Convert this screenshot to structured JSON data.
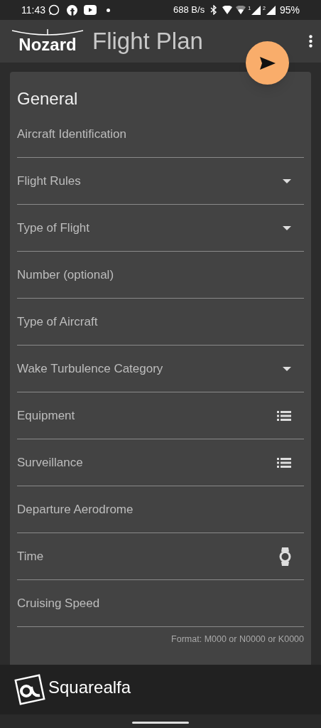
{
  "status_bar": {
    "time": "11:43",
    "speed": "688 B/s",
    "sims": [
      "1",
      "2"
    ],
    "battery": "95%"
  },
  "app_bar": {
    "logo": "Nozard",
    "title": "Flight Plan"
  },
  "card": {
    "title": "General",
    "fields": [
      {
        "label": "Aircraft Identification",
        "kind": "text"
      },
      {
        "label": "Flight Rules",
        "kind": "dropdown"
      },
      {
        "label": "Type of Flight",
        "kind": "dropdown"
      },
      {
        "label": "Number (optional)",
        "kind": "text"
      },
      {
        "label": "Type of Aircraft",
        "kind": "text"
      },
      {
        "label": "Wake Turbulence Category",
        "kind": "dropdown"
      },
      {
        "label": "Equipment",
        "kind": "list"
      },
      {
        "label": "Surveillance",
        "kind": "list"
      },
      {
        "label": "Departure Aerodrome",
        "kind": "text"
      },
      {
        "label": "Time",
        "kind": "time"
      },
      {
        "label": "Cruising Speed",
        "kind": "text",
        "helper": "Format: M000 or N0000 or K0000"
      }
    ]
  },
  "ad_banner": {
    "brand": "Squarealfa"
  }
}
